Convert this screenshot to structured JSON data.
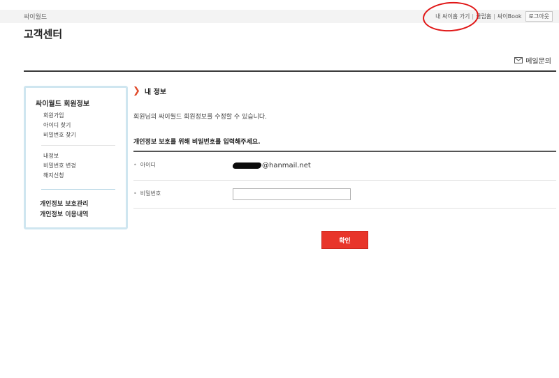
{
  "topbar": {
    "site_name": "싸이월드",
    "nav": {
      "my_cyhome": "내 싸이홈 가기",
      "club": "클럽홈",
      "cybook": "싸이Book",
      "logout": "로그아웃"
    }
  },
  "header": {
    "page_title": "고객센터",
    "mail_link": "메일문의"
  },
  "sidebar": {
    "head": "싸이월드 회원정보",
    "group1": [
      "회원가입",
      "아이디 찾기",
      "비밀번호 찾기"
    ],
    "group2": [
      "내정보",
      "비밀번호 변경",
      "해지신청"
    ],
    "bold_items": [
      "개인정보 보호관리",
      "개인정보 이용내역"
    ]
  },
  "main": {
    "section_title": "내 정보",
    "description": "회원님의 싸이월드 회원정보를 수정할 수 있습니다.",
    "notice": "개인정보 보호를 위해 비밀번호를 입력해주세요.",
    "id_label": "아이디",
    "id_value": "@hanmail.net",
    "password_label": "비밀번호",
    "password_value": "",
    "confirm_label": "확인"
  },
  "colors": {
    "accent_red": "#e8352a",
    "sidebar_border": "#cfe6f0",
    "annotation_circle": "#e01616"
  },
  "icons": [
    "mail-icon",
    "chevron-right-icon"
  ]
}
